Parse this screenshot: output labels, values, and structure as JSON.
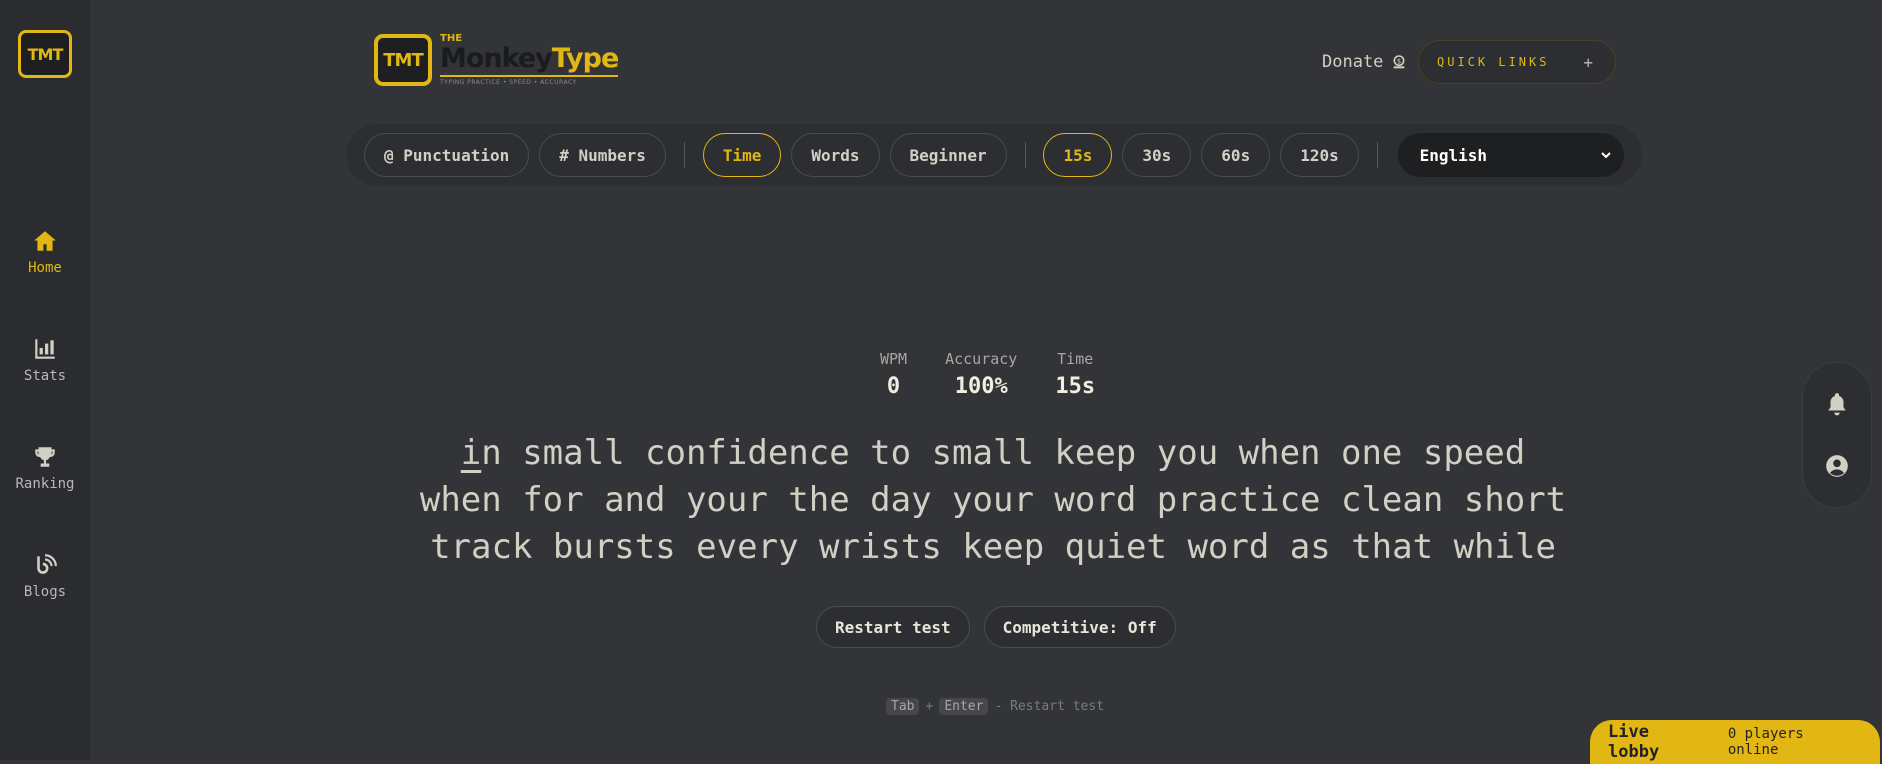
{
  "sidebar": {
    "logo_text": "TMT",
    "items": [
      {
        "label": "Home",
        "active": true,
        "icon": "home-icon"
      },
      {
        "label": "Stats",
        "active": false,
        "icon": "bar-chart-icon"
      },
      {
        "label": "Ranking",
        "active": false,
        "icon": "trophy-icon"
      },
      {
        "label": "Blogs",
        "active": false,
        "icon": "blog-icon"
      }
    ]
  },
  "header": {
    "logo_badge": "TMT",
    "brand_the": "THE",
    "brand_monkey": "Monkey",
    "brand_type": "Type",
    "brand_tagline": "TYPING PRACTICE • SPEED • ACCURACY",
    "donate_label": "Donate",
    "quick_links_label": "QUICK LINKS",
    "quick_links_plus": "+"
  },
  "toolbar": {
    "punctuation": "@ Punctuation",
    "numbers": "# Numbers",
    "modes": [
      {
        "label": "Time",
        "active": true
      },
      {
        "label": "Words",
        "active": false
      },
      {
        "label": "Beginner",
        "active": false
      }
    ],
    "durations": [
      {
        "label": "15s",
        "active": true
      },
      {
        "label": "30s",
        "active": false
      },
      {
        "label": "60s",
        "active": false
      },
      {
        "label": "120s",
        "active": false
      }
    ],
    "language": "English"
  },
  "stats": {
    "wpm_label": "WPM",
    "wpm_value": "0",
    "accuracy_label": "Accuracy",
    "accuracy_value": "100%",
    "time_label": "Time",
    "time_value": "15s"
  },
  "words": {
    "line1_first": "i",
    "line1_rest": "n small confidence to small keep you when one speed",
    "line2": "when for and your the day your word practice clean short",
    "line3": "track bursts every wrists keep quiet word as that while"
  },
  "actions": {
    "restart": "Restart test",
    "competitive": "Competitive: Off"
  },
  "hint": {
    "key1": "Tab",
    "plus": "+",
    "key2": "Enter",
    "text": "- Restart test"
  },
  "lobby": {
    "title": "Live lobby",
    "count": "0 players online"
  },
  "colors": {
    "accent": "#e2b714",
    "background": "#323437",
    "sidebar": "#2a2c2f"
  }
}
